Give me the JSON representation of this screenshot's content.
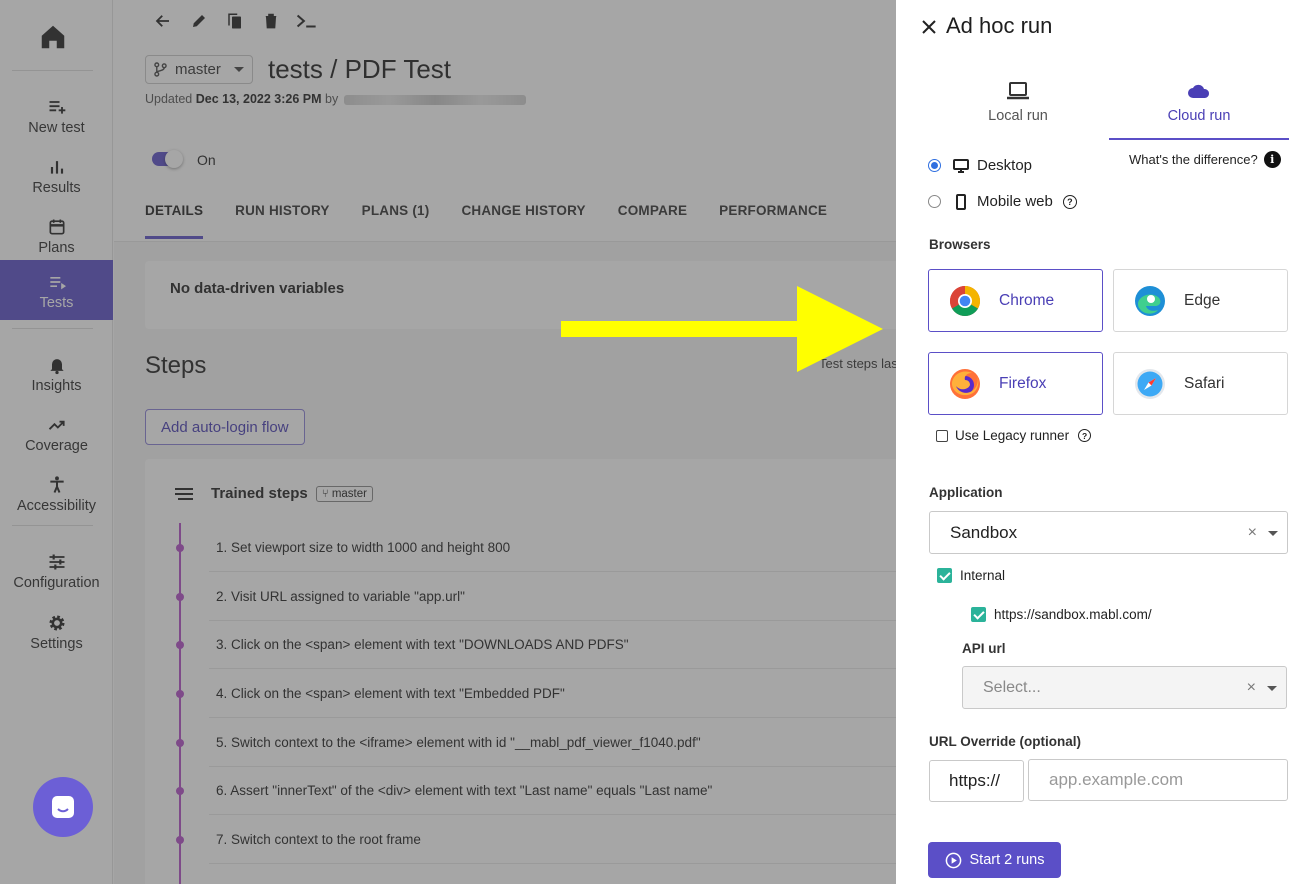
{
  "nav": {
    "items": [
      {
        "label": "New test",
        "icon": "playlist-add-icon"
      },
      {
        "label": "Results",
        "icon": "bar-chart-icon"
      },
      {
        "label": "Plans",
        "icon": "calendar-icon"
      },
      {
        "label": "Tests",
        "icon": "list-icon",
        "active": true
      },
      {
        "label": "Insights",
        "icon": "bell-icon"
      },
      {
        "label": "Coverage",
        "icon": "trending-up-icon"
      },
      {
        "label": "Accessibility",
        "icon": "accessibility-icon"
      },
      {
        "label": "Configuration",
        "icon": "sliders-icon"
      },
      {
        "label": "Settings",
        "icon": "gear-icon"
      }
    ]
  },
  "test": {
    "branch": "master",
    "title": "tests / PDF Test",
    "updated_prefix": "Updated ",
    "updated_date": "Dec 13, 2022 3:26 PM",
    "updated_by": " by ",
    "toggle_label": "On"
  },
  "tabs": [
    "DETAILS",
    "RUN HISTORY",
    "PLANS (1)",
    "CHANGE HISTORY",
    "COMPARE",
    "PERFORMANCE"
  ],
  "details": {
    "vars_text": "No data-driven variables",
    "steps_heading": "Steps",
    "steps_note": "Test steps las",
    "autologin_label": "Add auto-login flow",
    "trained_label": "Trained steps",
    "trained_branch": "master",
    "steps": [
      "1. Set viewport size to width 1000 and height 800",
      "2. Visit URL assigned to variable \"app.url\"",
      "3. Click on the <span> element with text \"DOWNLOADS AND PDFS\"",
      "4. Click on the <span> element with text \"Embedded PDF\"",
      "5. Switch context to the <iframe> element with id \"__mabl_pdf_viewer_f1040.pdf\"",
      "6. Assert \"innerText\" of the <div> element with text \"Last name\" equals \"Last name\"",
      "7. Switch context to the root frame"
    ]
  },
  "panel": {
    "title": "Ad hoc run",
    "run_tabs": [
      {
        "label": "Local run",
        "icon": "laptop-icon"
      },
      {
        "label": "Cloud run",
        "icon": "cloud-icon",
        "active": true
      }
    ],
    "difference_link": "What's the difference?",
    "device_options": [
      {
        "label": "Desktop",
        "icon": "desktop-icon",
        "selected": true
      },
      {
        "label": "Mobile web",
        "icon": "mobile-icon",
        "selected": false
      }
    ],
    "browsers_label": "Browsers",
    "browsers": [
      {
        "label": "Chrome",
        "icon": "chrome-icon",
        "selected": true
      },
      {
        "label": "Edge",
        "icon": "edge-icon",
        "selected": false
      },
      {
        "label": "Firefox",
        "icon": "firefox-icon",
        "selected": true
      },
      {
        "label": "Safari",
        "icon": "safari-icon",
        "selected": false
      }
    ],
    "legacy_runner": "Use Legacy runner",
    "application_label": "Application",
    "application_value": "Sandbox",
    "internal_label": "Internal",
    "internal_url": "https://sandbox.mabl.com/",
    "api_url_label": "API url",
    "api_url_placeholder": "Select...",
    "url_override_label": "URL Override (optional)",
    "url_protocol": "https://",
    "url_placeholder": "app.example.com",
    "start_label": "Start 2 runs"
  },
  "colors": {
    "accent": "#5b4fc7",
    "timeline": "#b24fc7",
    "check": "#2bb39a",
    "arrow": "#ffff00"
  }
}
